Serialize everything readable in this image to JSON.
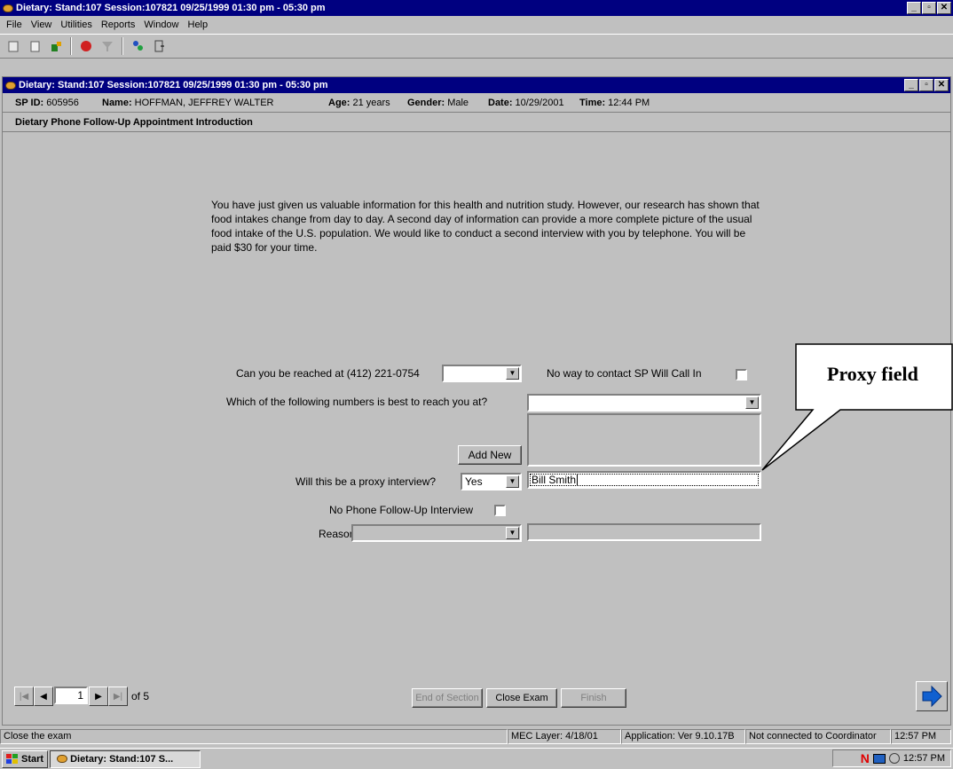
{
  "app": {
    "title": "Dietary: Stand:107 Session:107821 09/25/1999 01:30 pm - 05:30 pm",
    "min": "_",
    "max": "▫",
    "close": "✕"
  },
  "menu": [
    "File",
    "View",
    "Utilities",
    "Reports",
    "Window",
    "Help"
  ],
  "toolbar": {
    "icons": [
      "new-icon",
      "clipboard-icon",
      "open-icon",
      "stop-icon",
      "filter-icon",
      "people-icon",
      "exit-icon"
    ]
  },
  "child": {
    "title": "Dietary: Stand:107 Session:107821 09/25/1999 01:30 pm - 05:30 pm"
  },
  "sp": {
    "id_label": "SP ID:",
    "id": "605956",
    "name_label": "Name:",
    "name": "HOFFMAN, JEFFREY WALTER",
    "age_label": "Age:",
    "age": "21 years",
    "gender_label": "Gender:",
    "gender": "Male",
    "date_label": "Date:",
    "date": "10/29/2001",
    "time_label": "Time:",
    "time": "12:44 PM"
  },
  "screen_title": "Dietary Phone Follow-Up Appointment Introduction",
  "intro_text": "You have just given us valuable information for this health and nutrition study. However, our research has shown that food intakes change from day to day. A second day of information can provide a more complete picture of the usual food intake of the U.S. population. We would like to conduct a second interview with you by telephone. You will be paid $30 for your time.",
  "form": {
    "reach_label": "Can you be reached at (412) 221-0754",
    "reach_value": "",
    "no_contact_label": "No way to contact SP Will Call In",
    "best_number_label": "Which of the following numbers is best to reach you at?",
    "best_number_value": "",
    "add_new_label": "Add New",
    "proxy_label": "Will this be a proxy interview?",
    "proxy_value": "Yes",
    "proxy_name": "Bill Smith",
    "no_phone_label": "No Phone Follow-Up Interview",
    "reason_label": "Reason",
    "reason_value": "",
    "reason_text": ""
  },
  "callout": {
    "text": "Proxy field"
  },
  "nav": {
    "page": "1",
    "of": "of 5",
    "end_section": "End of Section",
    "close_exam": "Close Exam",
    "finish": "Finish"
  },
  "status": {
    "message": "Close the exam",
    "mec_layer": "MEC Layer: 4/18/01",
    "application": "Application: Ver 9.10.17B",
    "connection": "Not connected to Coordinator",
    "time": "12:57 PM"
  },
  "taskbar": {
    "start": "Start",
    "task": "Dietary: Stand:107 S...",
    "clock": "12:57 PM"
  }
}
